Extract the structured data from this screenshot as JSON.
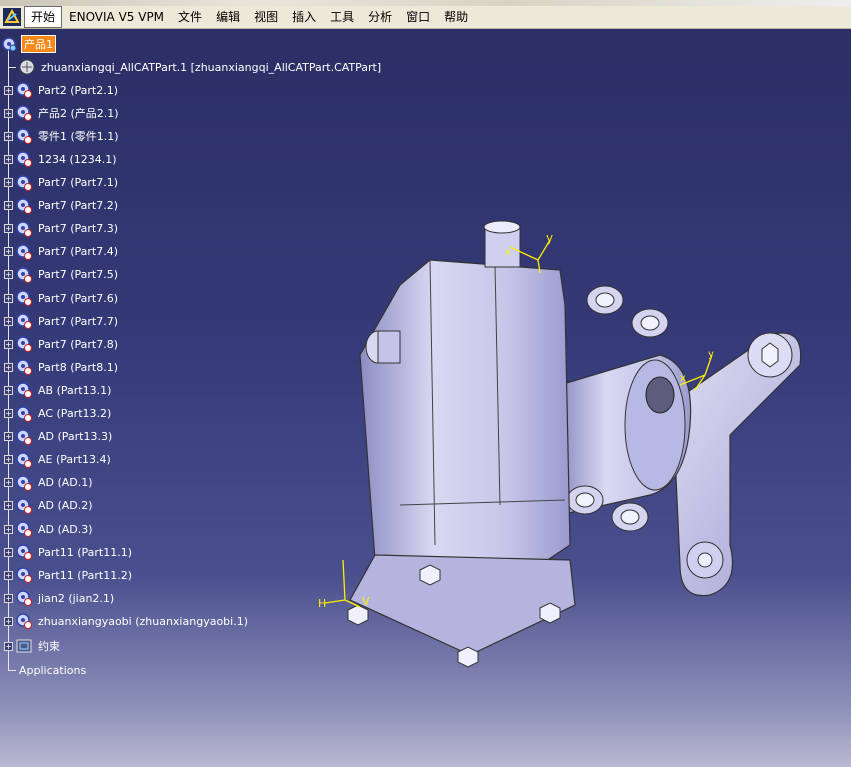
{
  "menubar": {
    "items": [
      "开始",
      "ENOVIA V5 VPM",
      "文件",
      "编辑",
      "视图",
      "插入",
      "工具",
      "分析",
      "窗口",
      "帮助"
    ]
  },
  "tree": {
    "root": "产品1",
    "nodes": [
      "zhuanxiangqi_AllCATPart.1 [zhuanxiangqi_AllCATPart.CATPart]",
      "Part2 (Part2.1)",
      "产品2 (产品2.1)",
      "零件1 (零件1.1)",
      "1234 (1234.1)",
      "Part7 (Part7.1)",
      "Part7 (Part7.2)",
      "Part7 (Part7.3)",
      "Part7 (Part7.4)",
      "Part7 (Part7.5)",
      "Part7 (Part7.6)",
      "Part7 (Part7.7)",
      "Part7 (Part7.8)",
      "Part8 (Part8.1)",
      "AB (Part13.1)",
      "AC (Part13.2)",
      "AD (Part13.3)",
      "AE (Part13.4)",
      "AD (AD.1)",
      "AD (AD.2)",
      "AD (AD.3)",
      "Part11 (Part11.1)",
      "Part11 (Part11.2)",
      "jian2 (jian2.1)",
      "zhuanxiangyaobi (zhuanxiangyaobi.1)"
    ],
    "constraints": "约束",
    "applications": "Applications"
  },
  "axes": {
    "top": [
      "x",
      "y"
    ],
    "right": [
      "x",
      "y"
    ],
    "bottom": [
      "H",
      "V"
    ]
  }
}
